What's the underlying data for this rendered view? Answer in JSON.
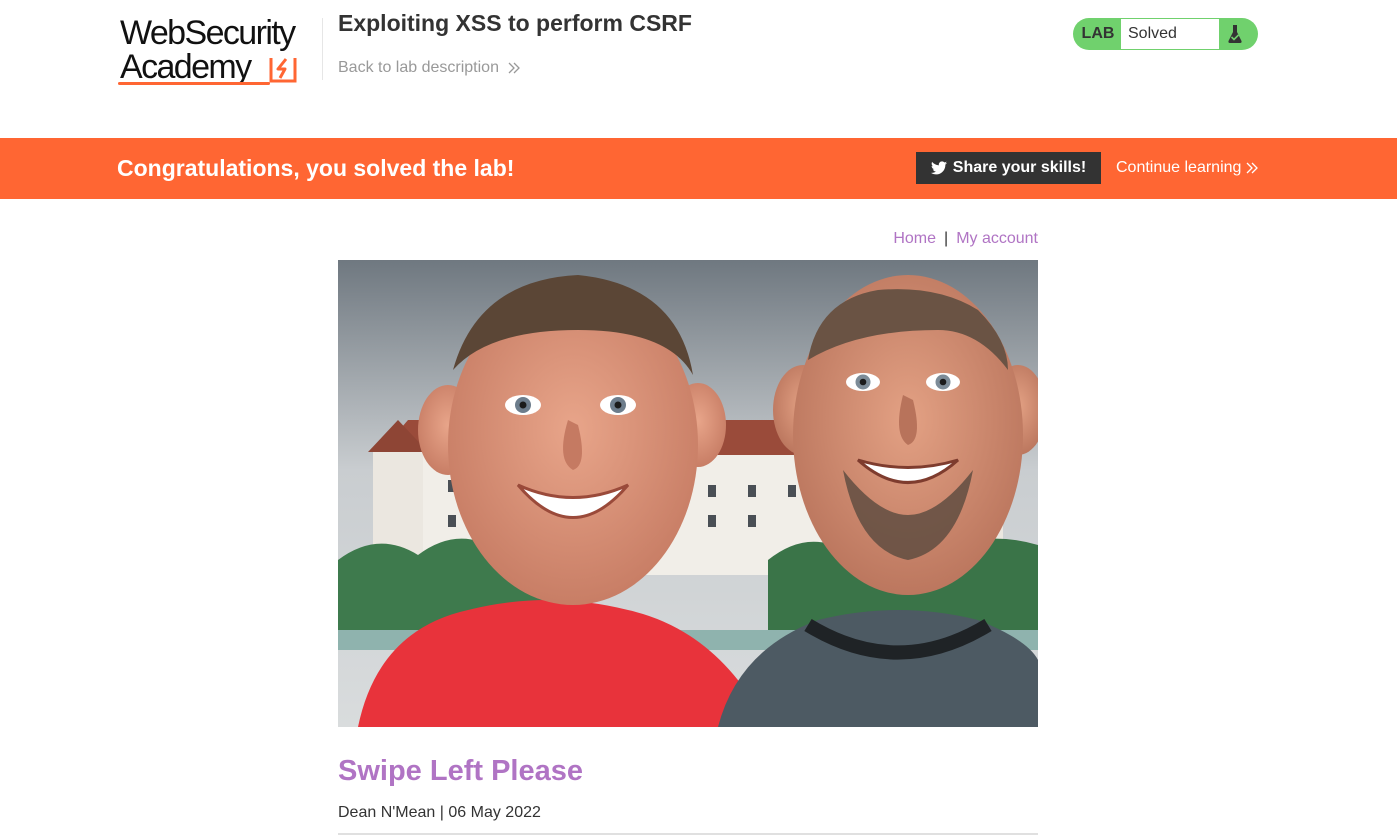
{
  "academy": {
    "logo_line1": "WebSecurity",
    "logo_line2": "Academy",
    "lab_title": "Exploiting XSS to perform CSRF",
    "back_link": "Back to lab description",
    "lab_badge": "LAB",
    "lab_status": "Solved"
  },
  "banner": {
    "message": "Congratulations, you solved the lab!",
    "share_button": "Share your skills!",
    "continue_link": "Continue learning"
  },
  "nav": {
    "home": "Home",
    "separator": "|",
    "my_account": "My account"
  },
  "post": {
    "image_icon": "blog-post-photo",
    "title": "Swipe Left Please",
    "meta": "Dean N'Mean | 06 May 2022"
  },
  "colors": {
    "brand_orange": "#ff6633",
    "solved_green": "#70d16d",
    "link_purple": "#b074c4",
    "dark_button": "#333333"
  }
}
